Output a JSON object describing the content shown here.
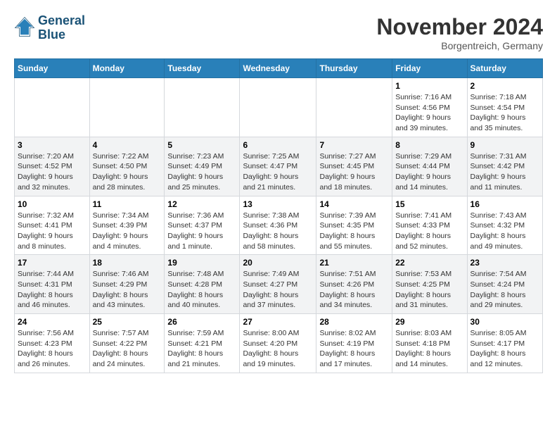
{
  "logo": {
    "text_line1": "General",
    "text_line2": "Blue"
  },
  "title": "November 2024",
  "subtitle": "Borgentreich, Germany",
  "weekdays": [
    "Sunday",
    "Monday",
    "Tuesday",
    "Wednesday",
    "Thursday",
    "Friday",
    "Saturday"
  ],
  "weeks": [
    [
      {
        "day": "",
        "info": ""
      },
      {
        "day": "",
        "info": ""
      },
      {
        "day": "",
        "info": ""
      },
      {
        "day": "",
        "info": ""
      },
      {
        "day": "",
        "info": ""
      },
      {
        "day": "1",
        "info": "Sunrise: 7:16 AM\nSunset: 4:56 PM\nDaylight: 9 hours\nand 39 minutes."
      },
      {
        "day": "2",
        "info": "Sunrise: 7:18 AM\nSunset: 4:54 PM\nDaylight: 9 hours\nand 35 minutes."
      }
    ],
    [
      {
        "day": "3",
        "info": "Sunrise: 7:20 AM\nSunset: 4:52 PM\nDaylight: 9 hours\nand 32 minutes."
      },
      {
        "day": "4",
        "info": "Sunrise: 7:22 AM\nSunset: 4:50 PM\nDaylight: 9 hours\nand 28 minutes."
      },
      {
        "day": "5",
        "info": "Sunrise: 7:23 AM\nSunset: 4:49 PM\nDaylight: 9 hours\nand 25 minutes."
      },
      {
        "day": "6",
        "info": "Sunrise: 7:25 AM\nSunset: 4:47 PM\nDaylight: 9 hours\nand 21 minutes."
      },
      {
        "day": "7",
        "info": "Sunrise: 7:27 AM\nSunset: 4:45 PM\nDaylight: 9 hours\nand 18 minutes."
      },
      {
        "day": "8",
        "info": "Sunrise: 7:29 AM\nSunset: 4:44 PM\nDaylight: 9 hours\nand 14 minutes."
      },
      {
        "day": "9",
        "info": "Sunrise: 7:31 AM\nSunset: 4:42 PM\nDaylight: 9 hours\nand 11 minutes."
      }
    ],
    [
      {
        "day": "10",
        "info": "Sunrise: 7:32 AM\nSunset: 4:41 PM\nDaylight: 9 hours\nand 8 minutes."
      },
      {
        "day": "11",
        "info": "Sunrise: 7:34 AM\nSunset: 4:39 PM\nDaylight: 9 hours\nand 4 minutes."
      },
      {
        "day": "12",
        "info": "Sunrise: 7:36 AM\nSunset: 4:37 PM\nDaylight: 9 hours\nand 1 minute."
      },
      {
        "day": "13",
        "info": "Sunrise: 7:38 AM\nSunset: 4:36 PM\nDaylight: 8 hours\nand 58 minutes."
      },
      {
        "day": "14",
        "info": "Sunrise: 7:39 AM\nSunset: 4:35 PM\nDaylight: 8 hours\nand 55 minutes."
      },
      {
        "day": "15",
        "info": "Sunrise: 7:41 AM\nSunset: 4:33 PM\nDaylight: 8 hours\nand 52 minutes."
      },
      {
        "day": "16",
        "info": "Sunrise: 7:43 AM\nSunset: 4:32 PM\nDaylight: 8 hours\nand 49 minutes."
      }
    ],
    [
      {
        "day": "17",
        "info": "Sunrise: 7:44 AM\nSunset: 4:31 PM\nDaylight: 8 hours\nand 46 minutes."
      },
      {
        "day": "18",
        "info": "Sunrise: 7:46 AM\nSunset: 4:29 PM\nDaylight: 8 hours\nand 43 minutes."
      },
      {
        "day": "19",
        "info": "Sunrise: 7:48 AM\nSunset: 4:28 PM\nDaylight: 8 hours\nand 40 minutes."
      },
      {
        "day": "20",
        "info": "Sunrise: 7:49 AM\nSunset: 4:27 PM\nDaylight: 8 hours\nand 37 minutes."
      },
      {
        "day": "21",
        "info": "Sunrise: 7:51 AM\nSunset: 4:26 PM\nDaylight: 8 hours\nand 34 minutes."
      },
      {
        "day": "22",
        "info": "Sunrise: 7:53 AM\nSunset: 4:25 PM\nDaylight: 8 hours\nand 31 minutes."
      },
      {
        "day": "23",
        "info": "Sunrise: 7:54 AM\nSunset: 4:24 PM\nDaylight: 8 hours\nand 29 minutes."
      }
    ],
    [
      {
        "day": "24",
        "info": "Sunrise: 7:56 AM\nSunset: 4:23 PM\nDaylight: 8 hours\nand 26 minutes."
      },
      {
        "day": "25",
        "info": "Sunrise: 7:57 AM\nSunset: 4:22 PM\nDaylight: 8 hours\nand 24 minutes."
      },
      {
        "day": "26",
        "info": "Sunrise: 7:59 AM\nSunset: 4:21 PM\nDaylight: 8 hours\nand 21 minutes."
      },
      {
        "day": "27",
        "info": "Sunrise: 8:00 AM\nSunset: 4:20 PM\nDaylight: 8 hours\nand 19 minutes."
      },
      {
        "day": "28",
        "info": "Sunrise: 8:02 AM\nSunset: 4:19 PM\nDaylight: 8 hours\nand 17 minutes."
      },
      {
        "day": "29",
        "info": "Sunrise: 8:03 AM\nSunset: 4:18 PM\nDaylight: 8 hours\nand 14 minutes."
      },
      {
        "day": "30",
        "info": "Sunrise: 8:05 AM\nSunset: 4:17 PM\nDaylight: 8 hours\nand 12 minutes."
      }
    ]
  ]
}
